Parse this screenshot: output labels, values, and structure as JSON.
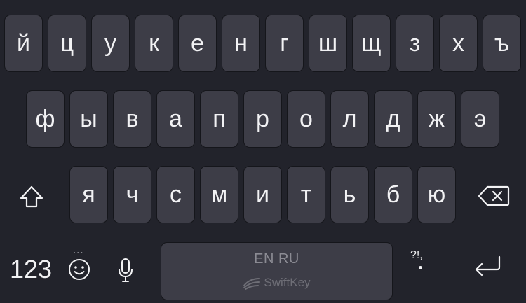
{
  "keyboard": {
    "row1": [
      "й",
      "ц",
      "у",
      "к",
      "е",
      "н",
      "г",
      "ш",
      "щ",
      "з",
      "х",
      "ъ"
    ],
    "row2": [
      "ф",
      "ы",
      "в",
      "а",
      "п",
      "р",
      "о",
      "л",
      "д",
      "ж",
      "э"
    ],
    "row3": [
      "я",
      "ч",
      "с",
      "м",
      "и",
      "т",
      "ь",
      "б",
      "ю"
    ],
    "shift_icon": "shift-arrow-icon",
    "backspace_icon": "backspace-icon",
    "numbers_label": "123",
    "emoji_more": "...",
    "emoji_icon": "smiley-icon",
    "mic_icon": "microphone-icon",
    "space": {
      "languages": "EN RU",
      "brand": "SwiftKey",
      "brand_icon": "swiftkey-logo-icon"
    },
    "punctuation": {
      "label": "?!,",
      "dot": "."
    },
    "enter_icon": "return-arrow-icon"
  },
  "colors": {
    "background": "#22232b",
    "key": "#3d3d47",
    "text": "#f2f2f4"
  }
}
